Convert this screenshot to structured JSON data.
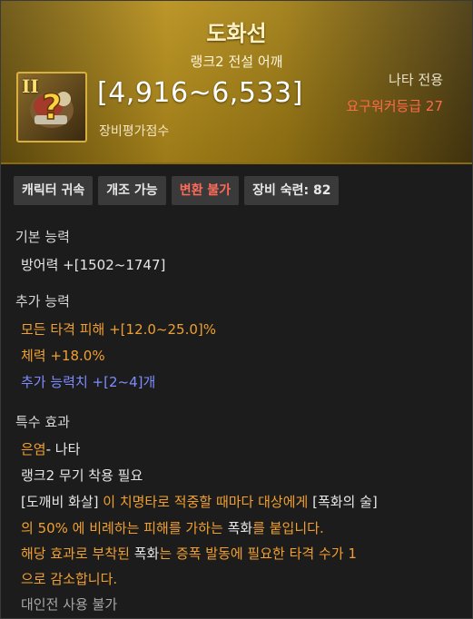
{
  "item": {
    "name": "도화선",
    "subtitle": "랭크2 전설 어깨",
    "rank_glyph": "II",
    "icon": "shoulder-armor-icon",
    "score": "[4,916~6,533]",
    "score_label": "장비평가점수",
    "class_only": "나타 전용",
    "required_level": "요구워커등급 27"
  },
  "badges": [
    {
      "label": "캐릭터 귀속"
    },
    {
      "label": "개조 가능"
    },
    {
      "label": "변환 불가"
    },
    {
      "label": "장비 숙련: 82"
    }
  ],
  "basic": {
    "title": "기본 능력",
    "line": "방어력  +[1502~1747]"
  },
  "extra": {
    "title": "추가 능력",
    "lines": [
      "모든 타격 피해  +[12.0~25.0]%",
      "체력  +18.0%",
      "추가 능력치 +[2~4]개"
    ]
  },
  "special": {
    "title": "특수 효과",
    "skill_name": "은염",
    "skill_suffix": "- 나타",
    "requirement": "랭크2 무기 착용 필요",
    "desc_1a": "[도깨비 화살]",
    "desc_1b": " 이 치명타로 적중할 때마다 대상에게 ",
    "desc_1c": "[폭화의 술]",
    "desc_2a": "의 50% 에 비례하는 피해를 가하는 ",
    "desc_2b": "폭화",
    "desc_2c": "를 붙입니다.",
    "desc_3a": "해당 효과로 부착된 ",
    "desc_3b": "폭화",
    "desc_3c": "는 증폭 발동에 필요한 타격 수가 1",
    "desc_4": "으로 감소합니다.",
    "pvp": "대인전 사용 불가"
  },
  "colors": {
    "header_gold": "#b8901c",
    "orange_text": "#f0a030",
    "purple_text": "#7f8cff",
    "warning_red": "#ff6a5a"
  }
}
